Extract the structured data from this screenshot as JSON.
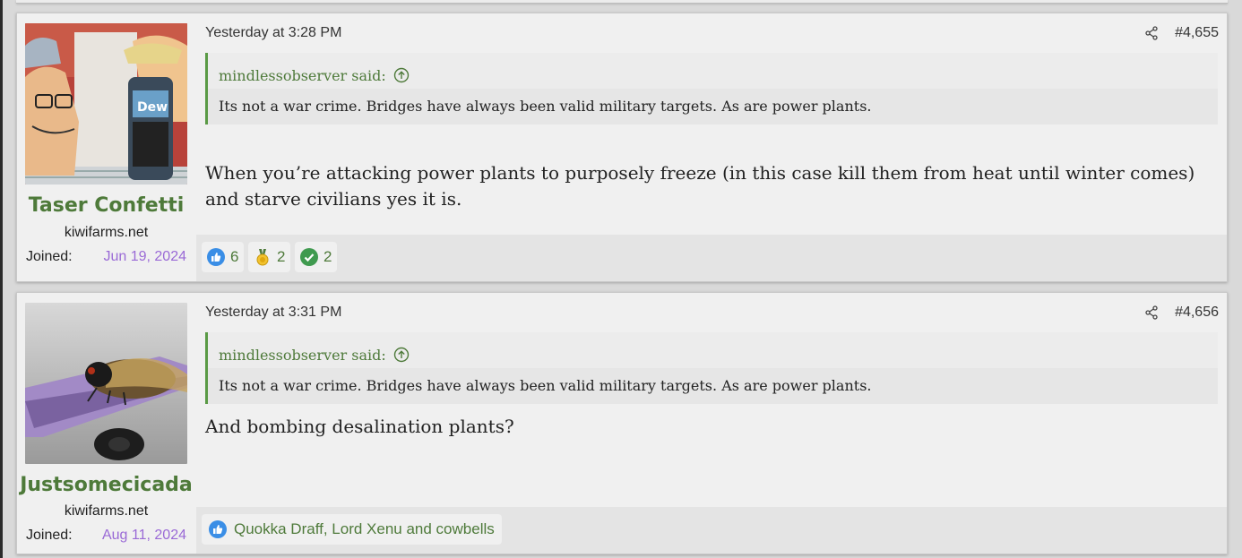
{
  "posts": [
    {
      "username": "Taser Confetti",
      "site": "kiwifarms.net",
      "joined_label": "Joined:",
      "joined_date": "Jun 19, 2024",
      "date": "Yesterday at 3:28 PM",
      "post_number": "#4,655",
      "quote_author": "mindlessobserver said:",
      "quote_text": "Its not a war crime. Bridges have always been valid military targets. As are power plants.",
      "message": "When you’re attacking power plants to purposely freeze (in this case kill them from heat until winter comes) and starve civilians yes it is.",
      "reactions": [
        {
          "icon": "thumbs-up-icon",
          "count": "6"
        },
        {
          "icon": "medal-icon",
          "count": "2"
        },
        {
          "icon": "check-icon",
          "count": "2"
        }
      ]
    },
    {
      "username": "Justsomecicada",
      "site": "kiwifarms.net",
      "joined_label": "Joined:",
      "joined_date": "Aug 11, 2024",
      "date": "Yesterday at 3:31 PM",
      "post_number": "#4,656",
      "quote_author": "mindlessobserver said:",
      "quote_text": "Its not a war crime. Bridges have always been valid military targets. As are power plants.",
      "message": "And bombing desalination plants?",
      "reaction_list": "Quokka Draff, Lord Xenu and cowbells"
    }
  ],
  "colors": {
    "accent_green": "#4e7a3a",
    "quote_border": "#5a9a45",
    "joined_date": "#9a6ad6",
    "like_blue": "#3a8ee6"
  }
}
